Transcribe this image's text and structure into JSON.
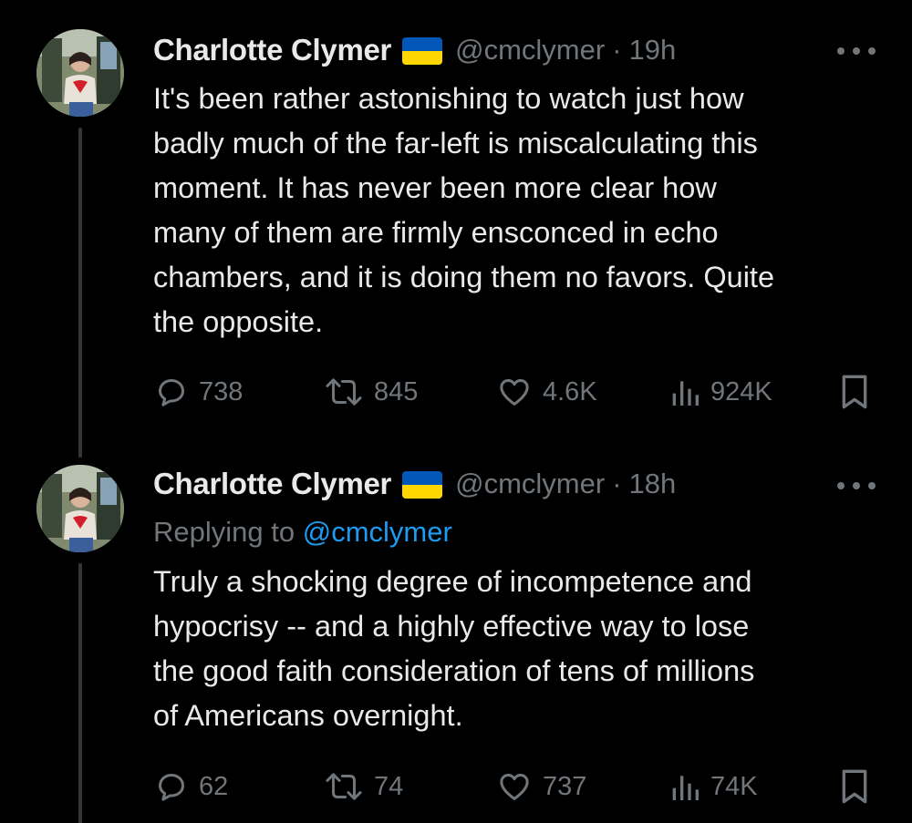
{
  "colors": {
    "background": "#000000",
    "text": "#e7e9ea",
    "muted": "#71767b",
    "link": "#1d9bf0",
    "thread_line": "#333639",
    "flag_blue": "#0057b7",
    "flag_yellow": "#ffd700"
  },
  "tweets": [
    {
      "name": "Charlotte Clymer",
      "flag": "ukraine-flag-icon",
      "handle": "@cmclymer",
      "separator": "·",
      "time": "19h",
      "reply_prefix": "",
      "reply_handle": "",
      "lines": [
        "It's been rather astonishing to watch just how",
        "badly much of the far-left is miscalculating this",
        "moment. It has never been more clear how",
        "many of them are firmly ensconced in echo",
        "chambers, and it is doing them no favors. Quite",
        "the opposite."
      ],
      "replies": "738",
      "reposts": "845",
      "likes": "4.6K",
      "views": "924K"
    },
    {
      "name": "Charlotte Clymer",
      "flag": "ukraine-flag-icon",
      "handle": "@cmclymer",
      "separator": "·",
      "time": "18h",
      "reply_prefix": "Replying to ",
      "reply_handle": "@cmclymer",
      "lines": [
        "Truly a shocking degree of incompetence and",
        "hypocrisy -- and a highly effective way to lose",
        "the good faith consideration of tens of millions",
        "of Americans overnight."
      ],
      "replies": "62",
      "reposts": "74",
      "likes": "737",
      "views": "74K"
    }
  ]
}
